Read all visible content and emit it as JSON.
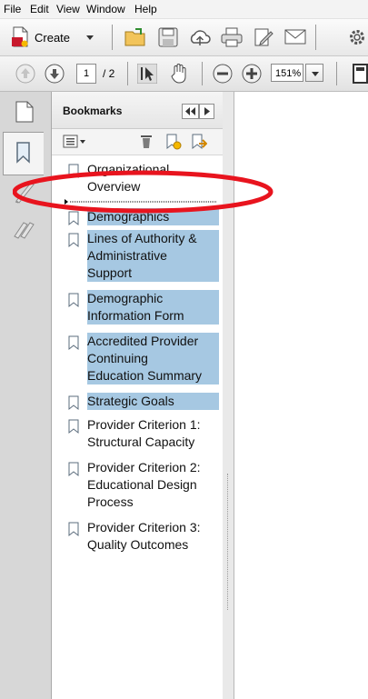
{
  "menu": {
    "items": [
      "File",
      "Edit",
      "View",
      "Window",
      "Help"
    ]
  },
  "toolbar": {
    "create_label": "Create"
  },
  "nav": {
    "page_value": "1",
    "page_total": "/ 2",
    "zoom": "151%"
  },
  "bookmarks": {
    "title": "Bookmarks",
    "items": [
      {
        "lines": [
          "Organizational",
          "Overview"
        ],
        "selected": false
      },
      {
        "lines": [
          "Demographics"
        ],
        "selected": true
      },
      {
        "lines": [
          "Lines of Authority &",
          "Administrative",
          "Support"
        ],
        "selected": true
      },
      {
        "lines": [
          "Demographic",
          "Information Form"
        ],
        "selected": true
      },
      {
        "lines": [
          "Accredited Provider",
          "Continuing",
          "Education Summary"
        ],
        "selected": true
      },
      {
        "lines": [
          "Strategic Goals"
        ],
        "selected": true
      },
      {
        "lines": [
          "Provider Criterion 1:",
          "Structural Capacity"
        ],
        "selected": false
      },
      {
        "lines": [
          "Provider Criterion 2:",
          "Educational Design",
          "Process"
        ],
        "selected": false
      },
      {
        "lines": [
          "Provider Criterion 3:",
          "Quality Outcomes"
        ],
        "selected": false
      }
    ]
  },
  "colors": {
    "selection": "#a6c8e2",
    "annotation": "#e8141e"
  }
}
